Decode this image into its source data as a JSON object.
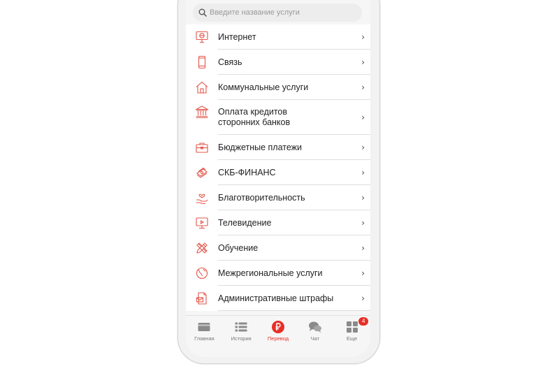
{
  "search": {
    "placeholder": "Введите название услуги",
    "value": ""
  },
  "services": [
    {
      "label": "Интернет",
      "icon": "monitor-globe-icon"
    },
    {
      "label": "Связь",
      "icon": "smartphone-icon"
    },
    {
      "label": "Коммунальные услуги",
      "icon": "house-icon"
    },
    {
      "label": "Оплата кредитов сторонних банков",
      "icon": "bank-building-icon"
    },
    {
      "label": "Бюджетные платежи",
      "icon": "briefcase-icon"
    },
    {
      "label": "СКБ-ФИНАНС",
      "icon": "money-stack-icon"
    },
    {
      "label": "Благотворительность",
      "icon": "charity-hand-icon"
    },
    {
      "label": "Телевидение",
      "icon": "tv-icon"
    },
    {
      "label": "Обучение",
      "icon": "pencil-ruler-icon"
    },
    {
      "label": "Межрегиональные услуги",
      "icon": "globe-icon"
    },
    {
      "label": "Административные штрафы",
      "icon": "fine-document-icon"
    }
  ],
  "chevron": "›",
  "tabs": [
    {
      "label": "Главная",
      "icon": "card-icon"
    },
    {
      "label": "История",
      "icon": "list-icon"
    },
    {
      "label": "Перевод",
      "icon": "ruble-icon"
    },
    {
      "label": "Чат",
      "icon": "chat-bubbles-icon"
    },
    {
      "label": "Еще",
      "icon": "grid-icon",
      "badge": "4"
    }
  ],
  "colors": {
    "accent": "#e63027",
    "icon_stroke": "#e2574c",
    "tab_gray": "#8a8a8a"
  }
}
